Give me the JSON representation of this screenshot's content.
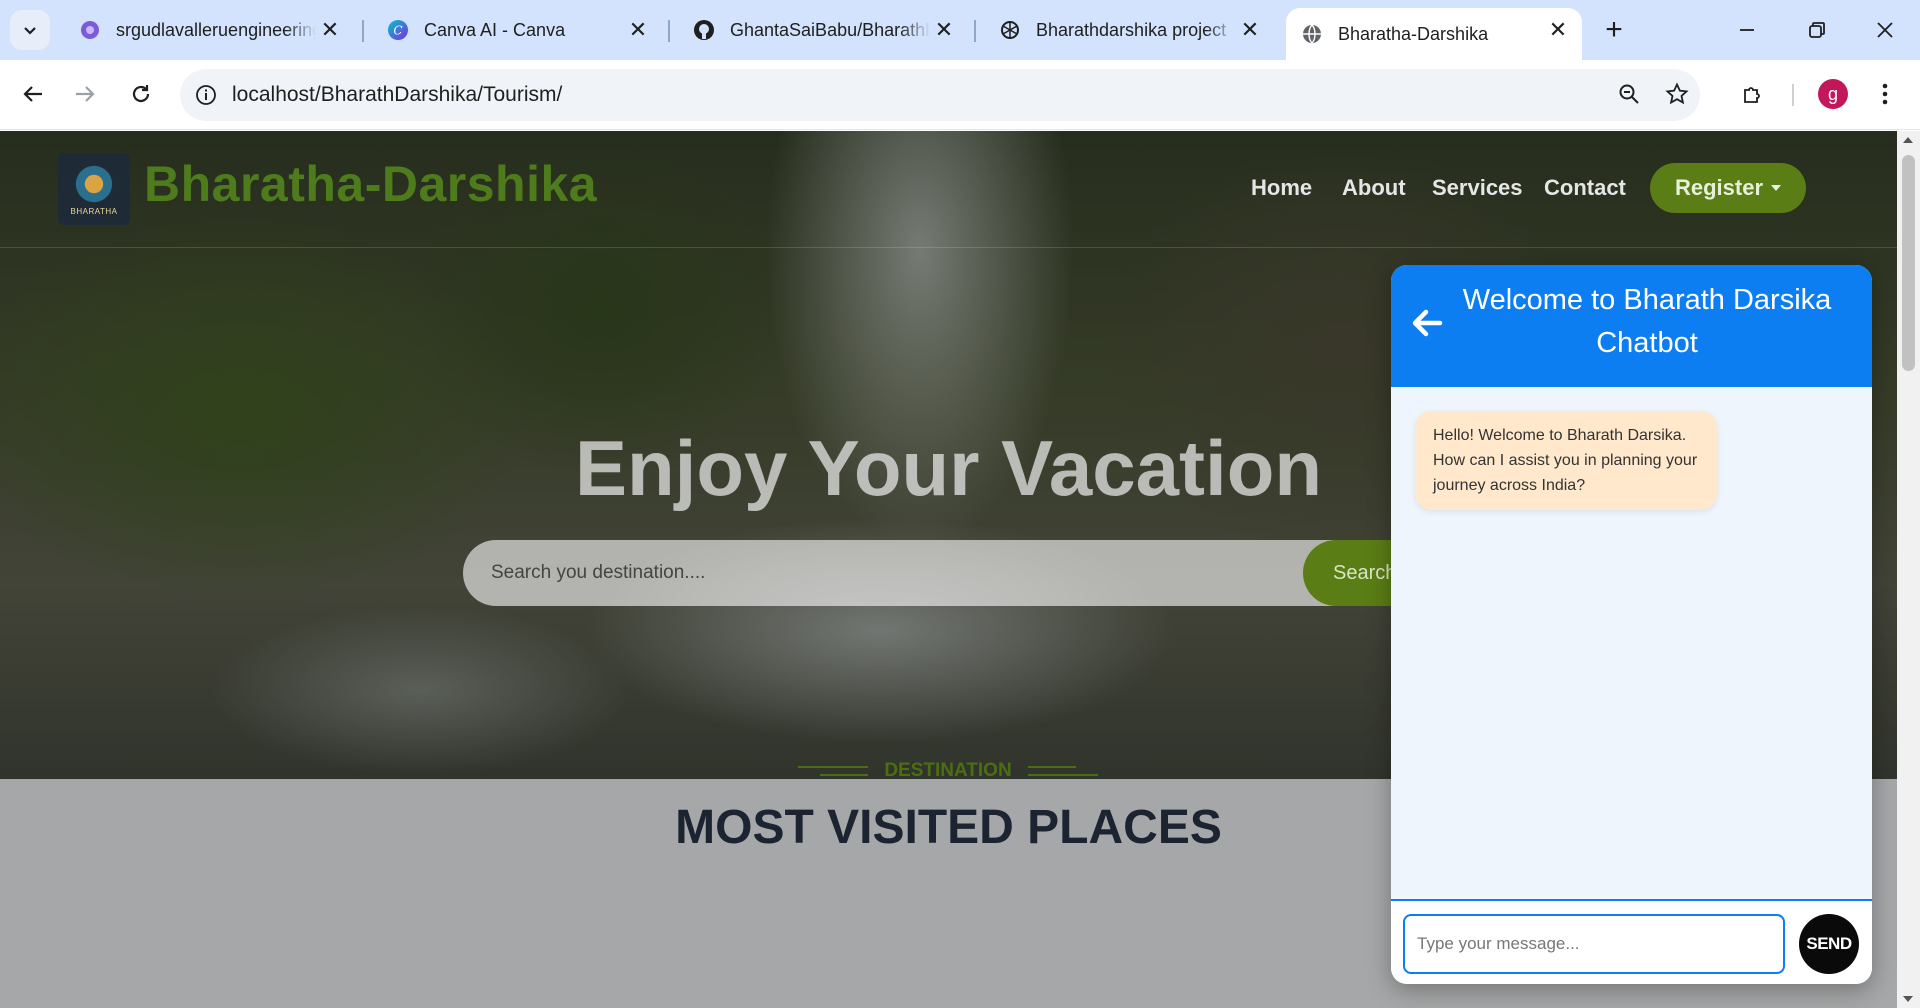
{
  "browser": {
    "tabs": [
      {
        "title": "srgudlavalleruengineering",
        "favicon": "purple-gear-icon"
      },
      {
        "title": "Canva AI - Canva",
        "favicon": "canva-icon"
      },
      {
        "title": "GhantaSaiBabu/BharathD",
        "favicon": "github-icon"
      },
      {
        "title": "Bharathdarshika project",
        "favicon": "openai-icon"
      },
      {
        "title": "Bharatha-Darshika",
        "favicon": "globe-icon",
        "active": true
      }
    ],
    "url_host": "localhost",
    "url_path": "/BharathDarshika/Tourism/",
    "profile_initial": "g",
    "accent": "#d3e3fd"
  },
  "site": {
    "brand": "Bharatha-Darshika",
    "logo_text": "BHARATHA",
    "nav": [
      "Home",
      "About",
      "Services",
      "Contact"
    ],
    "register_label": "Register",
    "hero_title": "Enjoy Your Vacation",
    "search_placeholder": "Search you destination....",
    "search_button": "Search",
    "eyebrow": "DESTINATION",
    "section_title": "MOST VISITED PLACES",
    "brand_color": "#4e7b1b"
  },
  "chatbot": {
    "title": "Welcome to Bharath Darsika Chatbot",
    "bot_message": "Hello! Welcome to Bharath Darsika. How can I assist you in planning your journey across India?",
    "input_placeholder": "Type your message...",
    "send_label": "SEND",
    "header_color": "#0d7df2",
    "bubble_color": "#ffe8cc"
  }
}
